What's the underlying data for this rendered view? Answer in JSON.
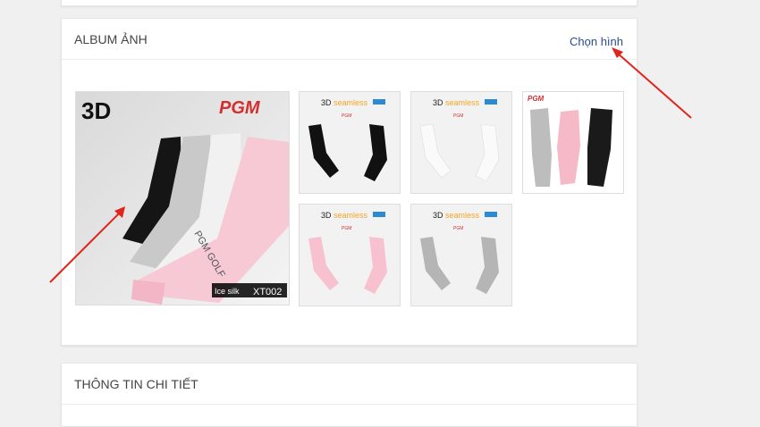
{
  "album": {
    "title": "ALBUM ẢNH",
    "choose_label": "Chọn hình",
    "main_image": {
      "badge_3d": "3D",
      "brand": "PGM",
      "product_line": "Ice silk",
      "model": "XT002",
      "sleeve_text": "PGM GOLF"
    },
    "thumbnails": [
      {
        "heading_a": "3D",
        "heading_b": "seamless",
        "brand": "PGM",
        "colors": [
          "#111111"
        ]
      },
      {
        "heading_a": "3D",
        "heading_b": "seamless",
        "brand": "PGM",
        "colors": [
          "#eeeeee"
        ]
      },
      {
        "brand": "PGM",
        "colors": [
          "#bdbdbd",
          "#f5b9c7",
          "#1a1a1a"
        ]
      },
      {
        "heading_a": "3D",
        "heading_b": "seamless",
        "brand": "PGM",
        "colors": [
          "#f7c1cf"
        ]
      },
      {
        "heading_a": "3D",
        "heading_b": "seamless",
        "brand": "PGM",
        "colors": [
          "#b5b5b5"
        ]
      }
    ]
  },
  "detail": {
    "title": "THÔNG TIN CHI TIẾT"
  },
  "colors": {
    "annotation_arrow": "#e0241b",
    "link": "#2a4b8d",
    "brand_red": "#d32f2f",
    "seamless_orange": "#f5a623"
  }
}
